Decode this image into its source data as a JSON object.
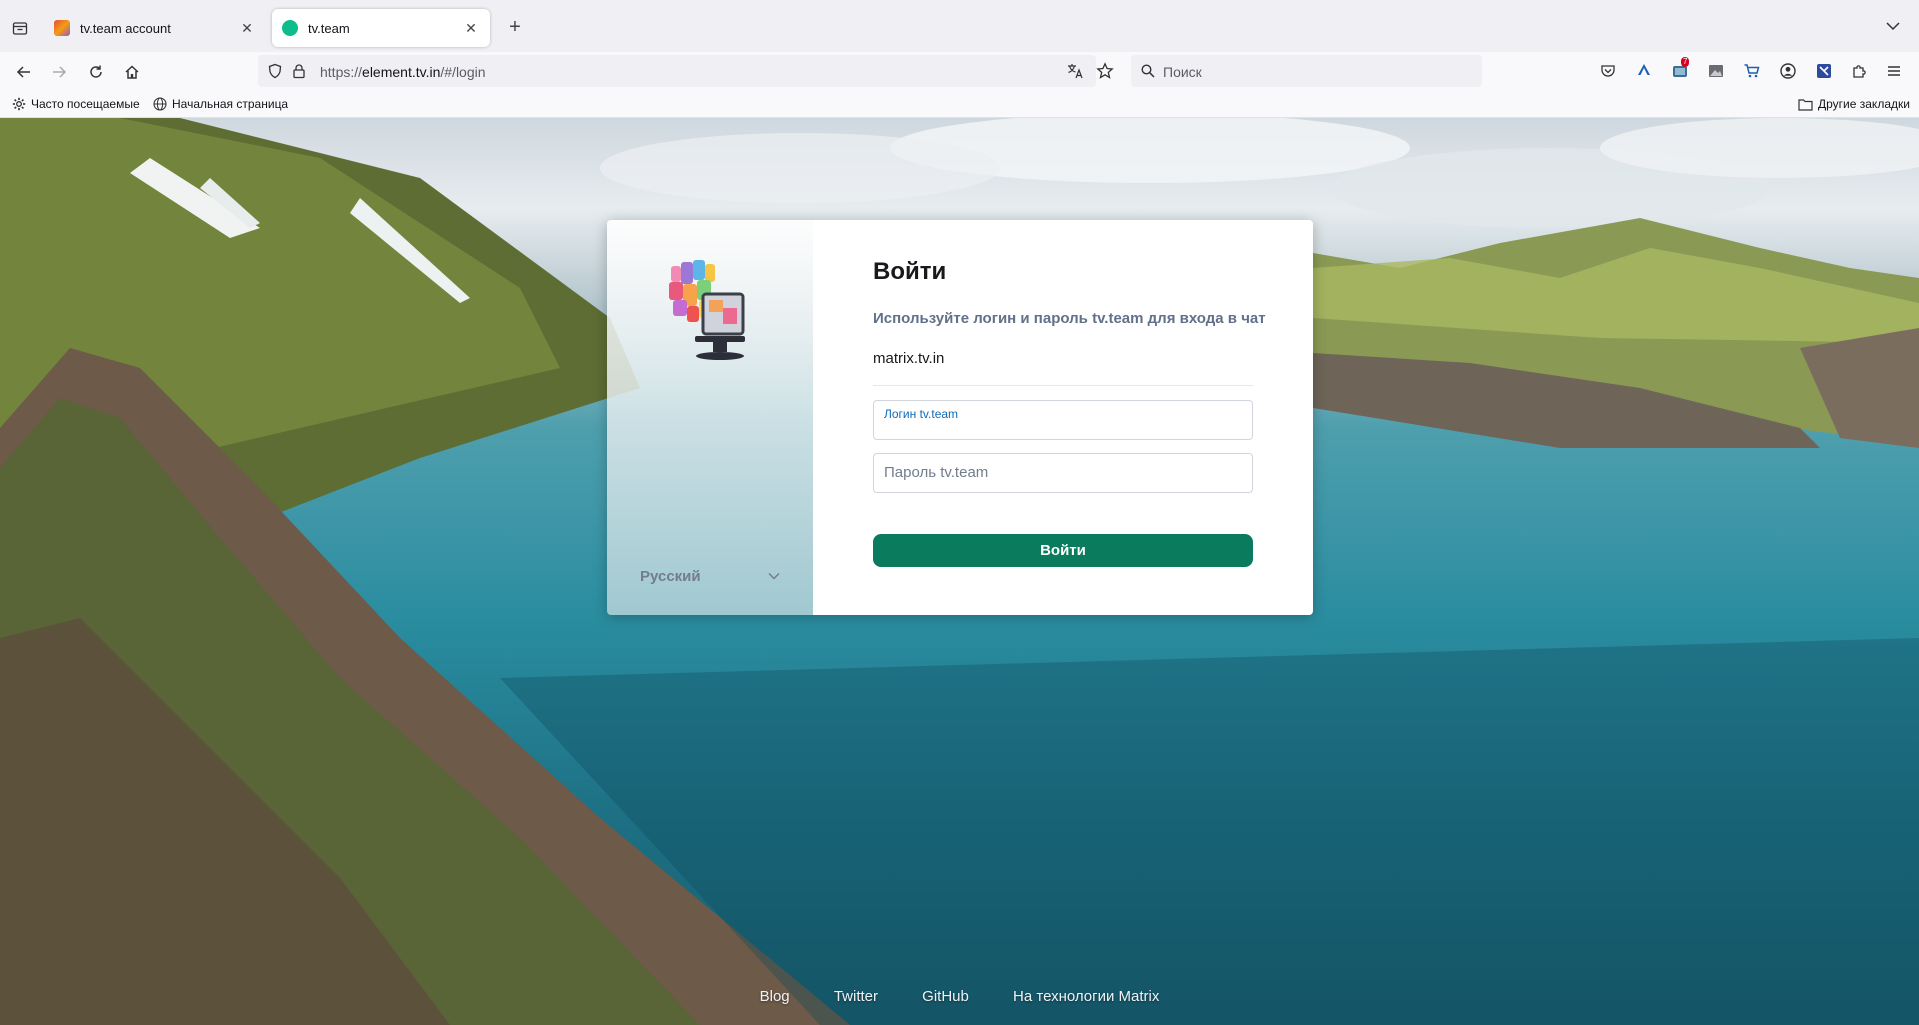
{
  "browser": {
    "tabs": [
      {
        "title": "tv.team account",
        "active": false
      },
      {
        "title": "tv.team",
        "active": true
      }
    ],
    "url": {
      "prefix": "https://",
      "host": "element.tv.in",
      "path": "/#/login"
    },
    "search_placeholder": "Поиск",
    "bookmarks": {
      "most_visited": "Часто посещаемые",
      "home_page": "Начальная страница",
      "other": "Другие закладки"
    },
    "badge_count": "7"
  },
  "login": {
    "title": "Войти",
    "subtitle": "Используйте логин и пароль tv.team для входа в чат",
    "server": "matrix.tv.in",
    "username_label": "Логин tv.team",
    "username_value": "",
    "password_placeholder": "Пароль tv.team",
    "submit_label": "Войти",
    "language": "Русский"
  },
  "footer": {
    "links": [
      "Blog",
      "Twitter",
      "GitHub",
      "На технологии Matrix"
    ]
  },
  "colors": {
    "accent": "#0a7b5d",
    "label_blue": "#0f6bb5"
  }
}
